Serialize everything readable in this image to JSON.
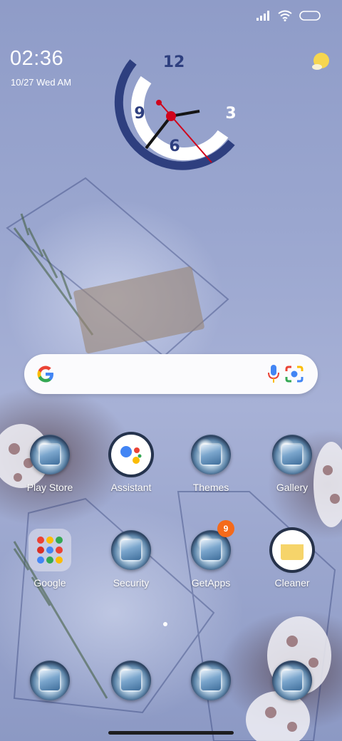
{
  "status_bar": {
    "signal_icon": "signal-icon",
    "wifi_icon": "wifi-icon",
    "battery_icon": "battery-icon"
  },
  "clock_widget": {
    "time": "02:36",
    "date": "10/27 Wed AM",
    "weather_icon": "sun-icon"
  },
  "analog_clock": {
    "numerals": [
      "12",
      "3",
      "6",
      "9"
    ],
    "hour": 2,
    "minute": 36,
    "accent": "#2e3f7f",
    "second_hand_color": "#d0021b"
  },
  "search": {
    "logo": "google-g-icon",
    "mic_icon": "mic-icon",
    "lens_icon": "lens-icon"
  },
  "apps_row1": [
    {
      "label": "Play Store",
      "icon": "play-store-icon"
    },
    {
      "label": "Assistant",
      "icon": "assistant-icon"
    },
    {
      "label": "Themes",
      "icon": "themes-icon"
    },
    {
      "label": "Gallery",
      "icon": "gallery-icon"
    }
  ],
  "apps_row2": [
    {
      "label": "Google",
      "icon": "google-folder-icon"
    },
    {
      "label": "Security",
      "icon": "security-icon"
    },
    {
      "label": "GetApps",
      "icon": "getapps-icon",
      "badge": "9"
    },
    {
      "label": "Cleaner",
      "icon": "cleaner-icon"
    }
  ],
  "dock": [
    {
      "icon": "phone-icon"
    },
    {
      "icon": "messages-icon"
    },
    {
      "icon": "browser-icon"
    },
    {
      "icon": "camera-icon"
    }
  ]
}
